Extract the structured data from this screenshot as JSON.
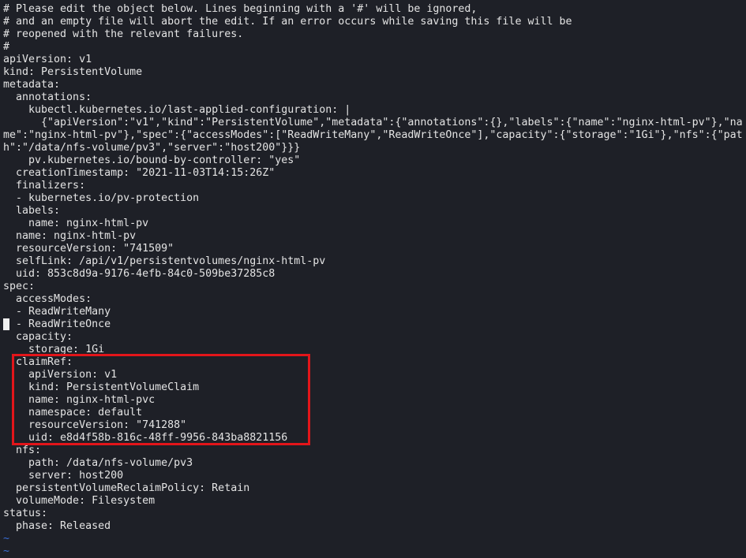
{
  "editor": {
    "lines": [
      "# Please edit the object below. Lines beginning with a '#' will be ignored,",
      "# and an empty file will abort the edit. If an error occurs while saving this file will be",
      "# reopened with the relevant failures.",
      "#",
      "apiVersion: v1",
      "kind: PersistentVolume",
      "metadata:",
      "  annotations:",
      "    kubectl.kubernetes.io/last-applied-configuration: |",
      "      {\"apiVersion\":\"v1\",\"kind\":\"PersistentVolume\",\"metadata\":{\"annotations\":{},\"labels\":{\"name\":\"nginx-html-pv\"},\"na",
      "me\":\"nginx-html-pv\"},\"spec\":{\"accessModes\":[\"ReadWriteMany\",\"ReadWriteOnce\"],\"capacity\":{\"storage\":\"1Gi\"},\"nfs\":{\"pat",
      "h\":\"/data/nfs-volume/pv3\",\"server\":\"host200\"}}}",
      "    pv.kubernetes.io/bound-by-controller: \"yes\"",
      "  creationTimestamp: \"2021-11-03T14:15:26Z\"",
      "  finalizers:",
      "  - kubernetes.io/pv-protection",
      "  labels:",
      "    name: nginx-html-pv",
      "  name: nginx-html-pv",
      "  resourceVersion: \"741509\"",
      "  selfLink: /api/v1/persistentvolumes/nginx-html-pv",
      "  uid: 853c8d9a-9176-4efb-84c0-509be37285c8",
      "spec:",
      "  accessModes:",
      "  - ReadWriteMany",
      "  - ReadWriteOnce",
      "  capacity:",
      "    storage: 1Gi",
      "  claimRef:",
      "    apiVersion: v1",
      "    kind: PersistentVolumeClaim",
      "    name: nginx-html-pvc",
      "    namespace: default",
      "    resourceVersion: \"741288\"",
      "    uid: e8d4f58b-816c-48ff-9956-843ba8821156",
      "  nfs:",
      "    path: /data/nfs-volume/pv3",
      "    server: host200",
      "  persistentVolumeReclaimPolicy: Retain",
      "  volumeMode: Filesystem",
      "status:",
      "  phase: Released"
    ],
    "empty_line_marker": "~",
    "colors": {
      "background": "#1e2027",
      "text": "#e4e4e4",
      "tilde": "#3a6fd8",
      "highlight_box": "#e3151a"
    }
  }
}
